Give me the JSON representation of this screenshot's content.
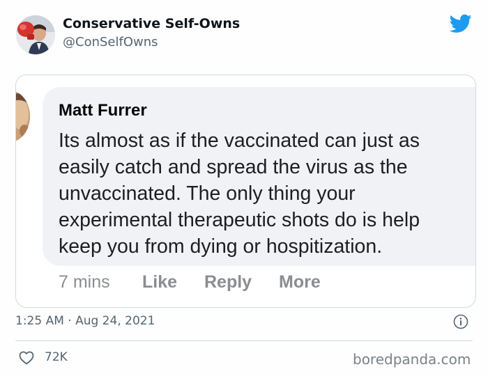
{
  "account": {
    "display_name": "Conservative Self-Owns",
    "handle": "@ConSelfOwns",
    "avatar_icon": "boxing-glove-avatar"
  },
  "brand_icon": "twitter-bird-icon",
  "colors": {
    "brand": "#1d9bf0",
    "text_primary": "#0f1419",
    "text_secondary": "#536471",
    "bubble_bg": "#f0f2f5"
  },
  "screenshot": {
    "author": "Matt Furrer",
    "lines": [
      "Its almost as if the vaccinated can just as",
      "easily catch and spread the virus as the",
      "unvaccinated. The only thing your",
      "experimental therapeutic shots do is help",
      "keep you from dying or hospitization."
    ],
    "time": "7 mins",
    "like": "Like",
    "reply": "Reply",
    "more": "More"
  },
  "meta": {
    "timestamp": "1:25 AM · Aug 24, 2021"
  },
  "stats": {
    "likes": "72K"
  },
  "watermark": "boredpanda.com"
}
